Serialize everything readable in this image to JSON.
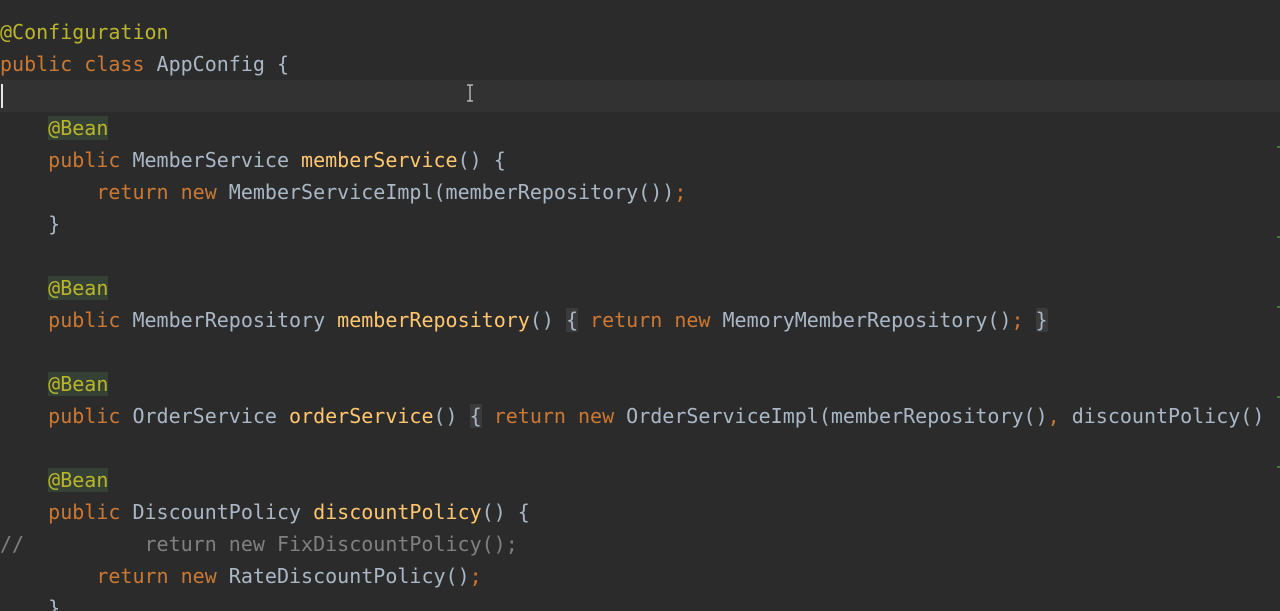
{
  "editor": {
    "lines": [
      [
        {
          "t": "@Configuration",
          "c": "ann"
        }
      ],
      [
        {
          "t": "public",
          "c": "kw"
        },
        {
          "t": " "
        },
        {
          "t": "class",
          "c": "kw"
        },
        {
          "t": " AppConfig {"
        }
      ],
      [],
      [
        {
          "t": "    "
        },
        {
          "t": "@Bean",
          "c": "ann ann-hl"
        }
      ],
      [
        {
          "t": "    "
        },
        {
          "t": "public",
          "c": "kw"
        },
        {
          "t": " MemberService "
        },
        {
          "t": "memberService",
          "c": "fn"
        },
        {
          "t": "() {"
        }
      ],
      [
        {
          "t": "        "
        },
        {
          "t": "return",
          "c": "kw"
        },
        {
          "t": " "
        },
        {
          "t": "new",
          "c": "kw"
        },
        {
          "t": " MemberServiceImpl(memberRepository())"
        },
        {
          "t": ";",
          "c": "punc-orange"
        }
      ],
      [
        {
          "t": "    }"
        }
      ],
      [],
      [
        {
          "t": "    "
        },
        {
          "t": "@Bean",
          "c": "ann ann-hl"
        }
      ],
      [
        {
          "t": "    "
        },
        {
          "t": "public",
          "c": "kw"
        },
        {
          "t": " MemberRepository "
        },
        {
          "t": "memberRepository",
          "c": "fn"
        },
        {
          "t": "() "
        },
        {
          "t": "{",
          "c": "fold"
        },
        {
          "t": " "
        },
        {
          "t": "return",
          "c": "kw"
        },
        {
          "t": " "
        },
        {
          "t": "new",
          "c": "kw"
        },
        {
          "t": " MemoryMemberRepository()"
        },
        {
          "t": ";",
          "c": "punc-orange"
        },
        {
          "t": " "
        },
        {
          "t": "}",
          "c": "fold"
        }
      ],
      [],
      [
        {
          "t": "    "
        },
        {
          "t": "@Bean",
          "c": "ann ann-hl"
        }
      ],
      [
        {
          "t": "    "
        },
        {
          "t": "public",
          "c": "kw"
        },
        {
          "t": " OrderService "
        },
        {
          "t": "orderService",
          "c": "fn"
        },
        {
          "t": "() "
        },
        {
          "t": "{",
          "c": "fold"
        },
        {
          "t": " "
        },
        {
          "t": "return",
          "c": "kw"
        },
        {
          "t": " "
        },
        {
          "t": "new",
          "c": "kw"
        },
        {
          "t": " OrderServiceImpl(memberRepository()"
        },
        {
          "t": ",",
          "c": "punc-orange"
        },
        {
          "t": " discountPolicy()"
        }
      ],
      [],
      [
        {
          "t": "    "
        },
        {
          "t": "@Bean",
          "c": "ann ann-hl"
        }
      ],
      [
        {
          "t": "    "
        },
        {
          "t": "public",
          "c": "kw"
        },
        {
          "t": " DiscountPolicy "
        },
        {
          "t": "discountPolicy",
          "c": "fn"
        },
        {
          "t": "() {"
        }
      ],
      [
        {
          "t": "//          return new FixDiscountPolicy();",
          "c": "cmt"
        }
      ],
      [
        {
          "t": "        "
        },
        {
          "t": "return",
          "c": "kw"
        },
        {
          "t": " "
        },
        {
          "t": "new",
          "c": "kw"
        },
        {
          "t": " RateDiscountPolicy()"
        },
        {
          "t": ";",
          "c": "punc-orange"
        }
      ],
      [
        {
          "t": "    }"
        }
      ]
    ]
  },
  "colors": {
    "background": "#2b2b2b",
    "current_line": "#323232",
    "keyword": "#cc7832",
    "annotation": "#bbb529",
    "method": "#ffc66d",
    "comment": "#808080",
    "text": "#a9b7c6"
  }
}
